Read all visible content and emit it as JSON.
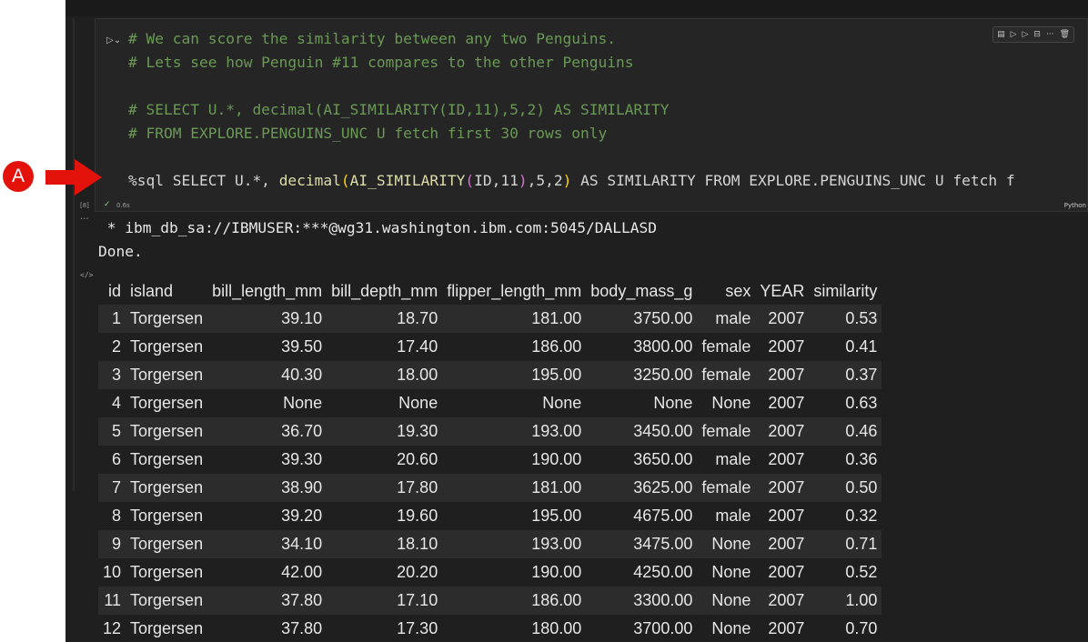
{
  "annotation": {
    "badge": "A"
  },
  "cell": {
    "code_lines": [
      "# We can score the similarity between any two Penguins.",
      "# Lets see how Penguin #11 compares to the other Penguins",
      "# SELECT U.*, decimal(AI_SIMILARITY(ID,11),5,2) AS SIMILARITY",
      "# FROM EXPLORE.PENGUINS_UNC U fetch first 30 rows only"
    ],
    "sql_parts": [
      "%sql SELECT U.*, ",
      "decimal",
      "(",
      "AI_SIMILARITY",
      "(",
      "ID,11",
      ")",
      ",5,2",
      ")",
      " AS SIMILARITY FROM EXPLORE.PENGUINS_UNC U fetch f"
    ],
    "execution_count": "[8]",
    "elapsed": "0.6s",
    "language": "Python"
  },
  "output": {
    "connection": " * ibm_db_sa://IBMUSER:***@wg31.washington.ibm.com:5045/DALLASD",
    "status": "Done.",
    "columns": [
      "id",
      "island",
      "bill_length_mm",
      "bill_depth_mm",
      "flipper_length_mm",
      "body_mass_g",
      "sex",
      "YEAR",
      "similarity"
    ],
    "rows": [
      [
        "1",
        "Torgersen",
        "39.10",
        "18.70",
        "181.00",
        "3750.00",
        "male",
        "2007",
        "0.53"
      ],
      [
        "2",
        "Torgersen",
        "39.50",
        "17.40",
        "186.00",
        "3800.00",
        "female",
        "2007",
        "0.41"
      ],
      [
        "3",
        "Torgersen",
        "40.30",
        "18.00",
        "195.00",
        "3250.00",
        "female",
        "2007",
        "0.37"
      ],
      [
        "4",
        "Torgersen",
        "None",
        "None",
        "None",
        "None",
        "None",
        "2007",
        "0.63"
      ],
      [
        "5",
        "Torgersen",
        "36.70",
        "19.30",
        "193.00",
        "3450.00",
        "female",
        "2007",
        "0.46"
      ],
      [
        "6",
        "Torgersen",
        "39.30",
        "20.60",
        "190.00",
        "3650.00",
        "male",
        "2007",
        "0.36"
      ],
      [
        "7",
        "Torgersen",
        "38.90",
        "17.80",
        "181.00",
        "3625.00",
        "female",
        "2007",
        "0.50"
      ],
      [
        "8",
        "Torgersen",
        "39.20",
        "19.60",
        "195.00",
        "4675.00",
        "male",
        "2007",
        "0.32"
      ],
      [
        "9",
        "Torgersen",
        "34.10",
        "18.10",
        "193.00",
        "3475.00",
        "None",
        "2007",
        "0.71"
      ],
      [
        "10",
        "Torgersen",
        "42.00",
        "20.20",
        "190.00",
        "4250.00",
        "None",
        "2007",
        "0.52"
      ],
      [
        "11",
        "Torgersen",
        "37.80",
        "17.10",
        "186.00",
        "3300.00",
        "None",
        "2007",
        "1.00"
      ],
      [
        "12",
        "Torgersen",
        "37.80",
        "17.30",
        "180.00",
        "3700.00",
        "None",
        "2007",
        "0.70"
      ]
    ]
  },
  "colors": {
    "editor_bg": "#1f1f1f",
    "comment": "#6a9955",
    "function": "#dcdcaa",
    "paren_gold": "#ffd700",
    "paren_pink": "#da70d6",
    "annotation_red": "#e3120b"
  }
}
